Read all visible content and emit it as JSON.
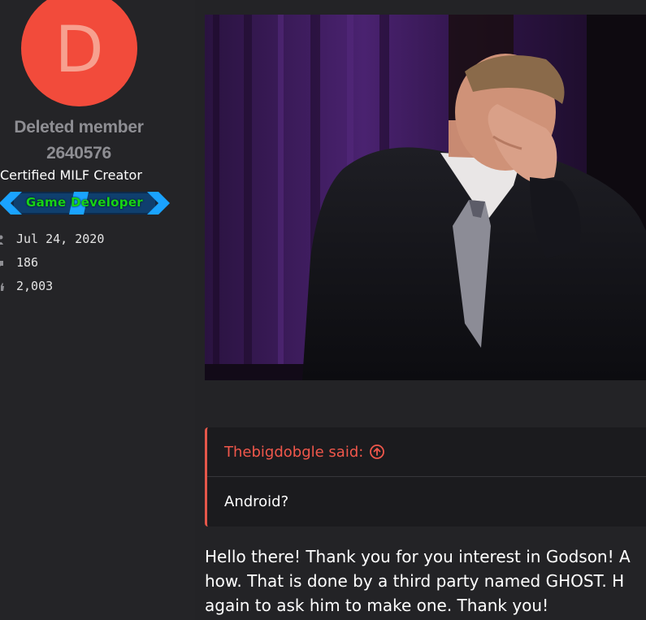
{
  "user": {
    "avatar_letter": "D",
    "name_line1": "Deleted member",
    "name_line2": "2640576",
    "title": "Certified MILF Creator",
    "banner_label": "Game Developer",
    "stats": {
      "joined": "Jul 24, 2020",
      "messages": "186",
      "reactions": "2,003"
    }
  },
  "post": {
    "media_alt": "facepalm gif",
    "quote": {
      "author_label": "Thebigdobgle said:",
      "text": "Android?"
    },
    "message_lines": [
      "Hello there! Thank you for you interest in Godson! A",
      "how. That is done by a third party named GHOST. H",
      "again to ask him to make one. Thank you!"
    ]
  },
  "colors": {
    "background": "#232326",
    "avatar": "#f24b3b",
    "quote_accent": "#e5574a",
    "banner_text": "#17d417",
    "banner_arrows": "#1aa3ff"
  },
  "icons": {
    "joined": "user-icon",
    "messages": "chat-icon",
    "reactions": "thumbs-up-icon",
    "jump": "arrow-circle-up-icon"
  }
}
